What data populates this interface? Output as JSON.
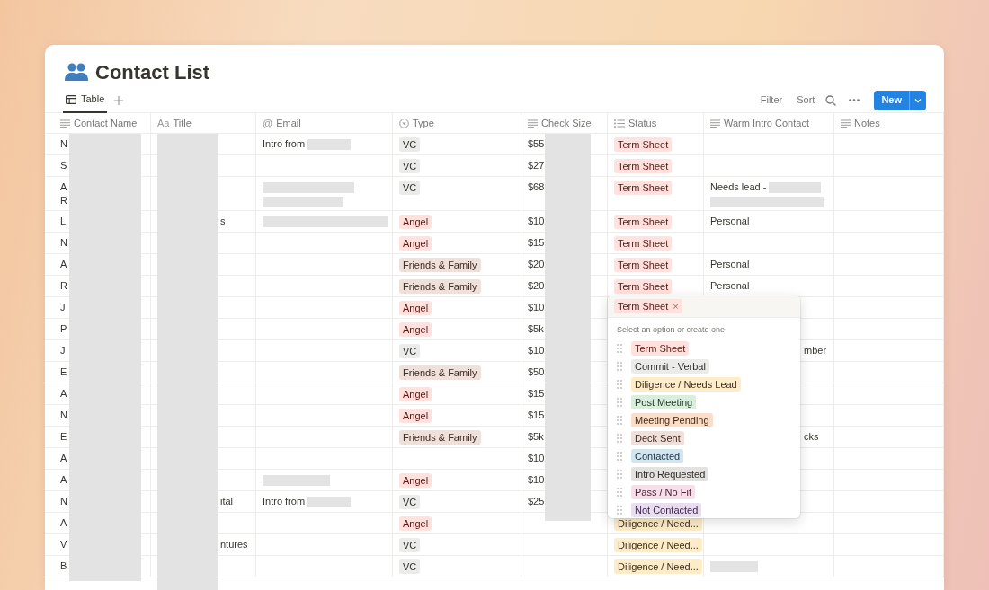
{
  "page": {
    "title": "Contact List"
  },
  "tabs": [
    {
      "label": "Table",
      "selected": true
    }
  ],
  "toolbar": {
    "filter": "Filter",
    "sort": "Sort",
    "new_button": "New"
  },
  "columns": [
    {
      "label": "Contact Name",
      "kind": "lines"
    },
    {
      "label": "Title",
      "kind": "glyph",
      "glyph": "Aa"
    },
    {
      "label": "Email",
      "kind": "glyph",
      "glyph": "@"
    },
    {
      "label": "Type",
      "kind": "select"
    },
    {
      "label": "Check Size",
      "kind": "lines"
    },
    {
      "label": "Status",
      "kind": "list"
    },
    {
      "label": "Warm Intro Contact",
      "kind": "lines"
    },
    {
      "label": "Notes",
      "kind": "lines"
    }
  ],
  "rows": [
    {
      "name": "N",
      "email": "Intro from",
      "email_redaction": {
        "kind": "short"
      },
      "type": {
        "label": "VC",
        "color": "#ebebea"
      },
      "check": "$55",
      "status": {
        "label": "Term Sheet",
        "color": "#ffe2dd"
      }
    },
    {
      "name": "S",
      "type": {
        "label": "VC",
        "color": "#ebebea"
      },
      "check": "$27",
      "status": {
        "label": "Term Sheet",
        "color": "#ffe2dd"
      }
    },
    {
      "name": "A\nR",
      "email_redaction": {
        "kind": "double"
      },
      "type": {
        "label": "VC",
        "color": "#ebebea"
      },
      "check": "$68",
      "status": {
        "label": "Term Sheet",
        "color": "#ffe2dd"
      },
      "warm": "Needs lead -",
      "warm_redaction": {
        "kind": "double"
      }
    },
    {
      "name": "L",
      "title": "s",
      "email_redaction": {
        "kind": "long"
      },
      "type": {
        "label": "Angel",
        "color": "#ffe2dd"
      },
      "check": "$10",
      "status": {
        "label": "Term Sheet",
        "color": "#ffe2dd"
      },
      "warm": "Personal"
    },
    {
      "name": "N",
      "type": {
        "label": "Angel",
        "color": "#ffe2dd"
      },
      "check": "$15",
      "status": {
        "label": "Term Sheet",
        "color": "#ffe2dd"
      }
    },
    {
      "name": "A",
      "type": {
        "label": "Friends & Family",
        "color": "#eee0da"
      },
      "check": "$20",
      "status": {
        "label": "Term Sheet",
        "color": "#ffe2dd"
      },
      "warm": "Personal"
    },
    {
      "name": "R",
      "type": {
        "label": "Friends & Family",
        "color": "#eee0da"
      },
      "check": "$20",
      "status": {
        "label": "Term Sheet",
        "color": "#ffe2dd"
      },
      "warm": "Personal"
    },
    {
      "name": "J",
      "type": {
        "label": "Angel",
        "color": "#ffe2dd"
      },
      "check": "$10"
    },
    {
      "name": "P",
      "type": {
        "label": "Angel",
        "color": "#ffe2dd"
      },
      "check": "$5k"
    },
    {
      "name": "J",
      "type": {
        "label": "VC",
        "color": "#ebebea"
      },
      "check": "$10",
      "warm": "mber"
    },
    {
      "name": "E",
      "type": {
        "label": "Friends & Family",
        "color": "#eee0da"
      },
      "check": "$50"
    },
    {
      "name": "A",
      "type": {
        "label": "Angel",
        "color": "#ffe2dd"
      },
      "check": "$15"
    },
    {
      "name": "N",
      "type": {
        "label": "Angel",
        "color": "#ffe2dd"
      },
      "check": "$15"
    },
    {
      "name": "E",
      "type": {
        "label": "Friends & Family",
        "color": "#eee0da"
      },
      "check": "$5k",
      "warm": "cks"
    },
    {
      "name": "A",
      "check": "$10"
    },
    {
      "name": "A",
      "email_redaction": {
        "kind": "medium"
      },
      "type": {
        "label": "Angel",
        "color": "#ffe2dd"
      },
      "check": "$10"
    },
    {
      "name": "N",
      "title": "ital",
      "email": "Intro from",
      "email_redaction": {
        "kind": "short"
      },
      "type": {
        "label": "VC",
        "color": "#ebebea"
      },
      "check": "$25"
    },
    {
      "name": "A",
      "type": {
        "label": "Angel",
        "color": "#ffe2dd"
      },
      "status": {
        "label": "Diligence / Need...",
        "color": "#fdecc8"
      }
    },
    {
      "name": "V",
      "title": "ntures",
      "type": {
        "label": "VC",
        "color": "#ebebea"
      },
      "status": {
        "label": "Diligence / Need...",
        "color": "#fdecc8"
      }
    },
    {
      "name": "B",
      "type": {
        "label": "VC",
        "color": "#ebebea"
      },
      "status": {
        "label": "Diligence / Need...",
        "color": "#fdecc8"
      },
      "warm_redaction": {
        "kind": "short"
      }
    }
  ],
  "status_menu": {
    "chosen": {
      "label": "Term Sheet",
      "color": "#ffe2dd",
      "remove": "×"
    },
    "hint": "Select an option or create one",
    "options": [
      {
        "label": "Term Sheet",
        "color": "#ffe2dd"
      },
      {
        "label": "Commit - Verbal",
        "color": "#ebebea"
      },
      {
        "label": "Diligence / Needs Lead",
        "color": "#fdecc8"
      },
      {
        "label": "Post Meeting",
        "color": "#dbeddb"
      },
      {
        "label": "Meeting Pending",
        "color": "#fadec9"
      },
      {
        "label": "Deck Sent",
        "color": "#eee0da"
      },
      {
        "label": "Contacted",
        "color": "#d3e5ef"
      },
      {
        "label": "Intro Requested",
        "color": "#e3e2e0"
      },
      {
        "label": "Pass / No Fit",
        "color": "#f5e0e9"
      },
      {
        "label": "Not Contacted",
        "color": "#e8deee"
      }
    ]
  }
}
